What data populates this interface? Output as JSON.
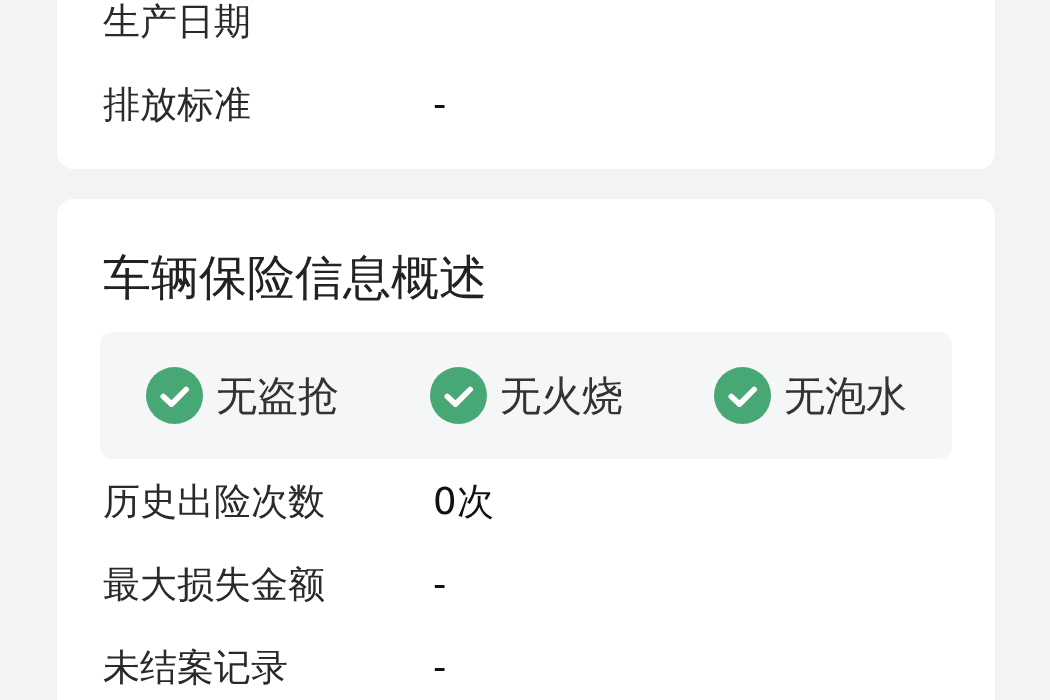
{
  "vehicle_card": {
    "rows": [
      {
        "label": "生产日期"
      },
      {
        "label": "排放标准",
        "value": "-"
      }
    ]
  },
  "insurance_card": {
    "title": "车辆保险信息概述",
    "checks": [
      {
        "label": "无盗抢",
        "checked": true
      },
      {
        "label": "无火烧",
        "checked": true
      },
      {
        "label": "无泡水",
        "checked": true
      }
    ],
    "rows": [
      {
        "label": "历史出险次数",
        "value": "0次"
      },
      {
        "label": "最大损失金额",
        "value": "-"
      },
      {
        "label": "未结案记录",
        "value": "-"
      }
    ]
  }
}
